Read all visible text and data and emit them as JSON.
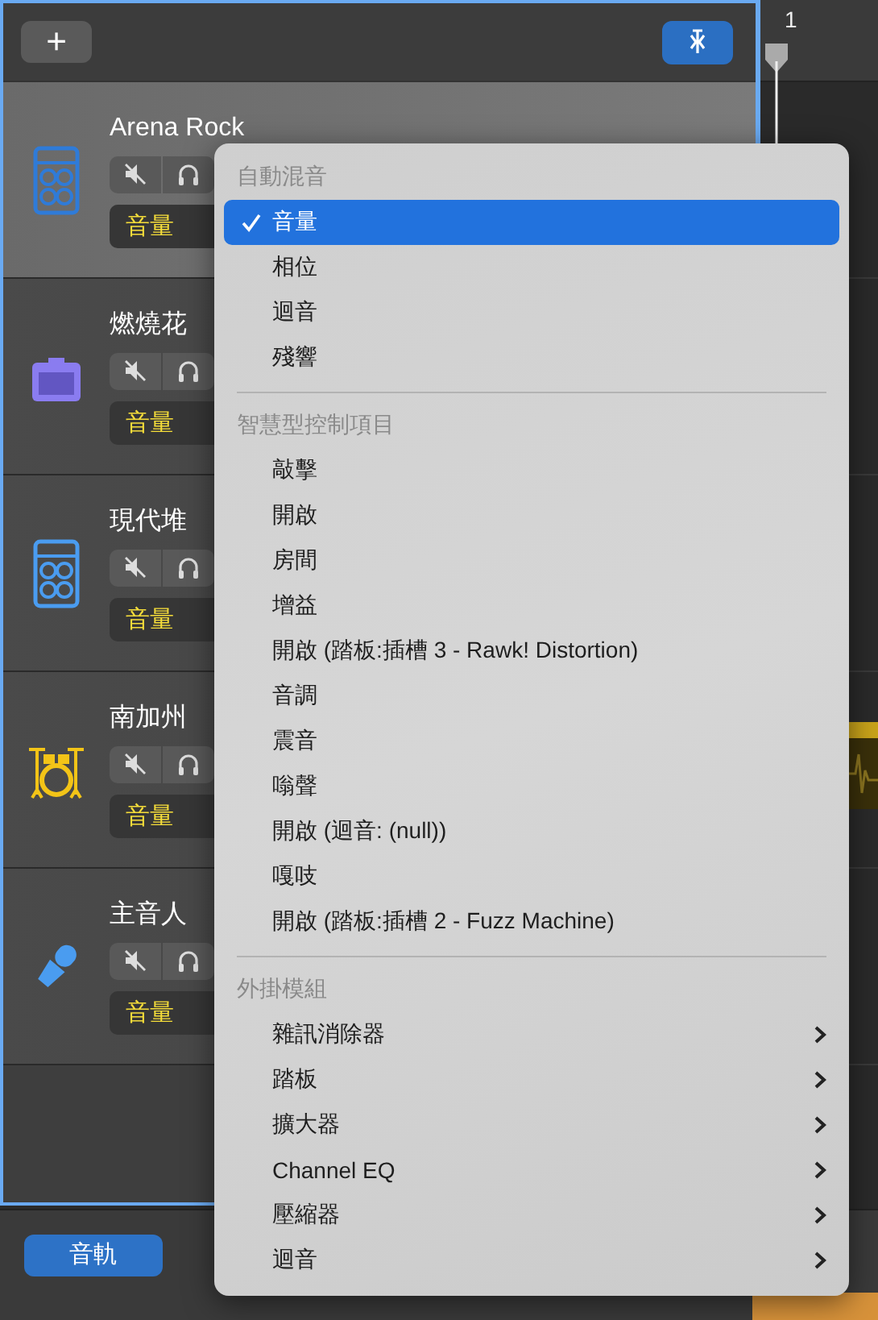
{
  "toolbar": {
    "add_button": "+"
  },
  "ruler": {
    "bar_number": "1"
  },
  "tracks": [
    {
      "name": "Arena Rock",
      "kind": "stack",
      "color": "#2f7bd8",
      "selected": true,
      "automation": "音量"
    },
    {
      "name": "燃燒花",
      "kind": "combo",
      "color": "#8a7cf0",
      "selected": false,
      "automation": "音量"
    },
    {
      "name": "現代堆",
      "kind": "stack",
      "color": "#4a9cf0",
      "selected": false,
      "automation": "音量"
    },
    {
      "name": "南加州",
      "kind": "drums",
      "color": "#f3c417",
      "selected": false,
      "automation": "音量"
    },
    {
      "name": "主音人",
      "kind": "mic",
      "color": "#4a9cf0",
      "selected": false,
      "automation": "音量"
    }
  ],
  "menu": {
    "sections": [
      {
        "header": "自動混音",
        "items": [
          {
            "label": "音量",
            "checked": true,
            "selected": true,
            "submenu": false
          },
          {
            "label": "相位",
            "checked": false,
            "selected": false,
            "submenu": false
          },
          {
            "label": "迴音",
            "checked": false,
            "selected": false,
            "submenu": false
          },
          {
            "label": "殘響",
            "checked": false,
            "selected": false,
            "submenu": false
          }
        ]
      },
      {
        "header": "智慧型控制項目",
        "items": [
          {
            "label": "敲擊",
            "checked": false,
            "selected": false,
            "submenu": false
          },
          {
            "label": "開啟",
            "checked": false,
            "selected": false,
            "submenu": false
          },
          {
            "label": "房間",
            "checked": false,
            "selected": false,
            "submenu": false
          },
          {
            "label": "增益",
            "checked": false,
            "selected": false,
            "submenu": false
          },
          {
            "label": "開啟 (踏板:插槽 3 - Rawk! Distortion)",
            "checked": false,
            "selected": false,
            "submenu": false
          },
          {
            "label": "音調",
            "checked": false,
            "selected": false,
            "submenu": false
          },
          {
            "label": "震音",
            "checked": false,
            "selected": false,
            "submenu": false
          },
          {
            "label": "嗡聲",
            "checked": false,
            "selected": false,
            "submenu": false
          },
          {
            "label": "開啟 (迴音: (null))",
            "checked": false,
            "selected": false,
            "submenu": false
          },
          {
            "label": "嘎吱",
            "checked": false,
            "selected": false,
            "submenu": false
          },
          {
            "label": "開啟 (踏板:插槽 2 - Fuzz Machine)",
            "checked": false,
            "selected": false,
            "submenu": false
          }
        ]
      },
      {
        "header": "外掛模組",
        "items": [
          {
            "label": "雜訊消除器",
            "checked": false,
            "selected": false,
            "submenu": true
          },
          {
            "label": "踏板",
            "checked": false,
            "selected": false,
            "submenu": true
          },
          {
            "label": "擴大器",
            "checked": false,
            "selected": false,
            "submenu": true
          },
          {
            "label": "Channel EQ",
            "checked": false,
            "selected": false,
            "submenu": true
          },
          {
            "label": "壓縮器",
            "checked": false,
            "selected": false,
            "submenu": true
          },
          {
            "label": "迴音",
            "checked": false,
            "selected": false,
            "submenu": true
          }
        ]
      }
    ]
  },
  "bottom_bar": {
    "tracks_button": {
      "label": "音軌",
      "selected": true
    }
  }
}
